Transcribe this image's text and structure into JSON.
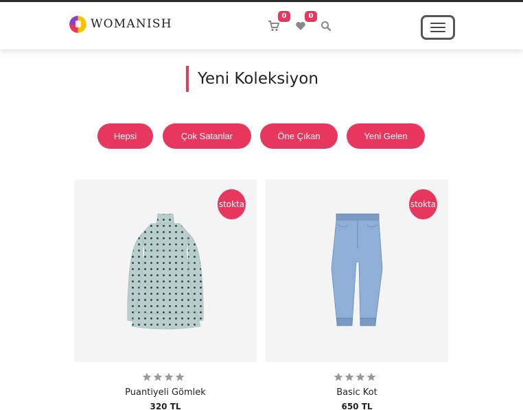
{
  "navbar": {
    "brand": "WOMANISH",
    "cart_count": "0",
    "wishlist_count": "0"
  },
  "section": {
    "title": "Yeni Koleksiyon"
  },
  "filters": [
    "Hepsi",
    "Çok Satanlar",
    "Öne Çıkan",
    "Yeni Gelen"
  ],
  "products": [
    {
      "name": "Puantiyeli Gömlek",
      "price": "320 TL",
      "badge": "stokta",
      "rating": 4,
      "image": "polka-dot-dress"
    },
    {
      "name": "Basic Kot",
      "price": "650 TL",
      "badge": "stokta",
      "rating": 4,
      "image": "jeans"
    }
  ],
  "colors": {
    "accent": "#e8375e",
    "card_bg": "#f4f4f4",
    "star": "#9a9a9a",
    "icon": "#888888"
  }
}
